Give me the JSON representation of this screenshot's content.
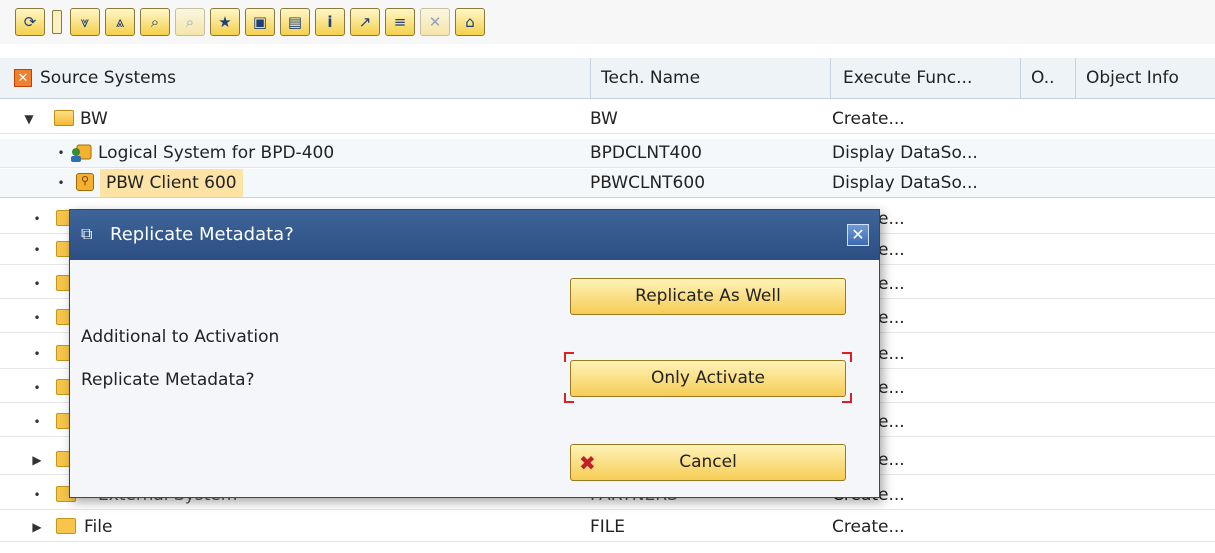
{
  "toolbar": {
    "buttons": [
      {
        "name": "refresh-button",
        "glyph": "⟳"
      },
      {
        "name": "collapse-button",
        "glyph": "⩔"
      },
      {
        "name": "expand-button",
        "glyph": "⩓"
      },
      {
        "name": "find-button",
        "glyph": "⌕"
      },
      {
        "name": "find-next-button",
        "glyph": "⌕"
      },
      {
        "name": "favorites-button",
        "glyph": "★"
      },
      {
        "name": "display-button",
        "glyph": "▣"
      },
      {
        "name": "tree-button",
        "glyph": "▤"
      },
      {
        "name": "info-button",
        "glyph": "i"
      },
      {
        "name": "jump-button",
        "glyph": "↗"
      },
      {
        "name": "layout-button",
        "glyph": "≡"
      },
      {
        "name": "delete-button",
        "glyph": "✕"
      },
      {
        "name": "hierarchy-button",
        "glyph": "⌂"
      }
    ]
  },
  "table": {
    "headers": [
      "Source Systems",
      "Tech. Name",
      "Execute Func...",
      "O..",
      "Object Info"
    ],
    "rows": [
      {
        "label": "BW",
        "tech": "BW",
        "func": "Create..."
      },
      {
        "label": "Logical System for BPD-400",
        "tech": "BPDCLNT400",
        "func": "Display DataSo..."
      },
      {
        "label": "PBW Client 600",
        "tech": "PBWCLNT600",
        "func": "Display DataSo..."
      },
      {
        "func": "Create..."
      },
      {
        "func": "Create..."
      },
      {
        "func": "Create..."
      },
      {
        "func": "Create..."
      },
      {
        "func": "Create..."
      },
      {
        "func": "Create..."
      },
      {
        "func": "Create..."
      },
      {
        "func": "Create..."
      },
      {
        "label": "External System",
        "tech": "PARTNERS",
        "func": "Create..."
      },
      {
        "label": "File",
        "tech": "FILE",
        "func": "Create..."
      }
    ]
  },
  "dialog": {
    "title": "Replicate Metadata?",
    "line1": "Additional to Activation",
    "line2": "Replicate Metadata?",
    "btn_replicate": "Replicate As Well",
    "btn_activate": "Only Activate",
    "btn_cancel": "Cancel"
  }
}
